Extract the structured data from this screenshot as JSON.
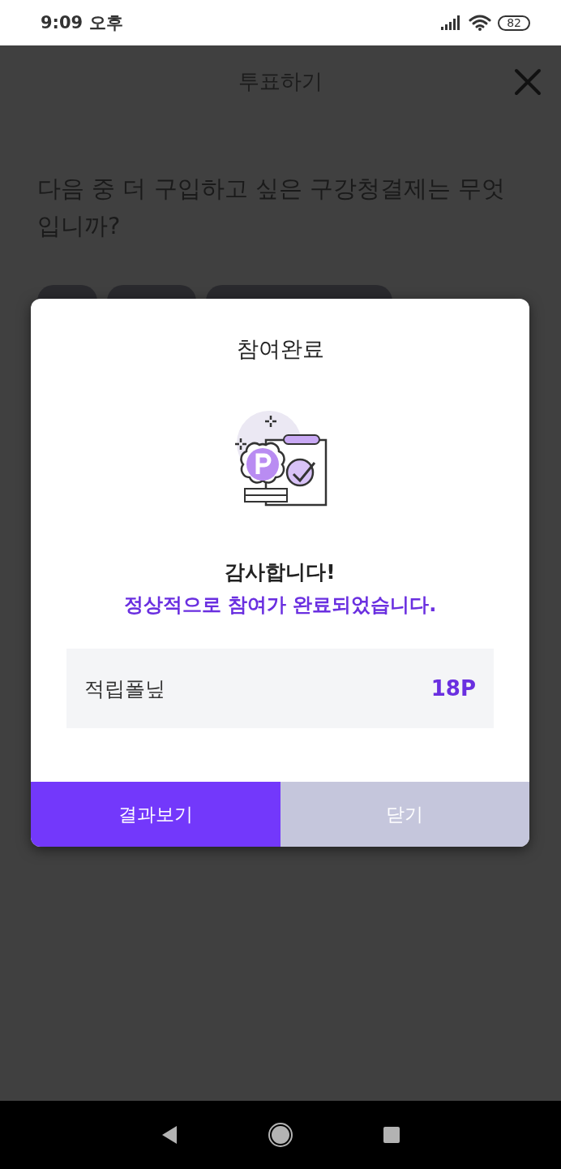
{
  "status_bar": {
    "time": "9:09 오후",
    "battery": "82"
  },
  "app_bar": {
    "title": "투표하기"
  },
  "question": "다음 중 더 구입하고 싶은 구강청결제는 무엇입니까?",
  "dialog": {
    "title": "참여완료",
    "thanks": "감사합니다!",
    "message": "정상적으로 참여가 완료되었습니다.",
    "reward": {
      "label": "적립폴닢",
      "value": "18P"
    },
    "buttons": [
      {
        "label": "결과보기",
        "kind": "primary"
      },
      {
        "label": "닫기",
        "kind": "secondary"
      }
    ]
  }
}
